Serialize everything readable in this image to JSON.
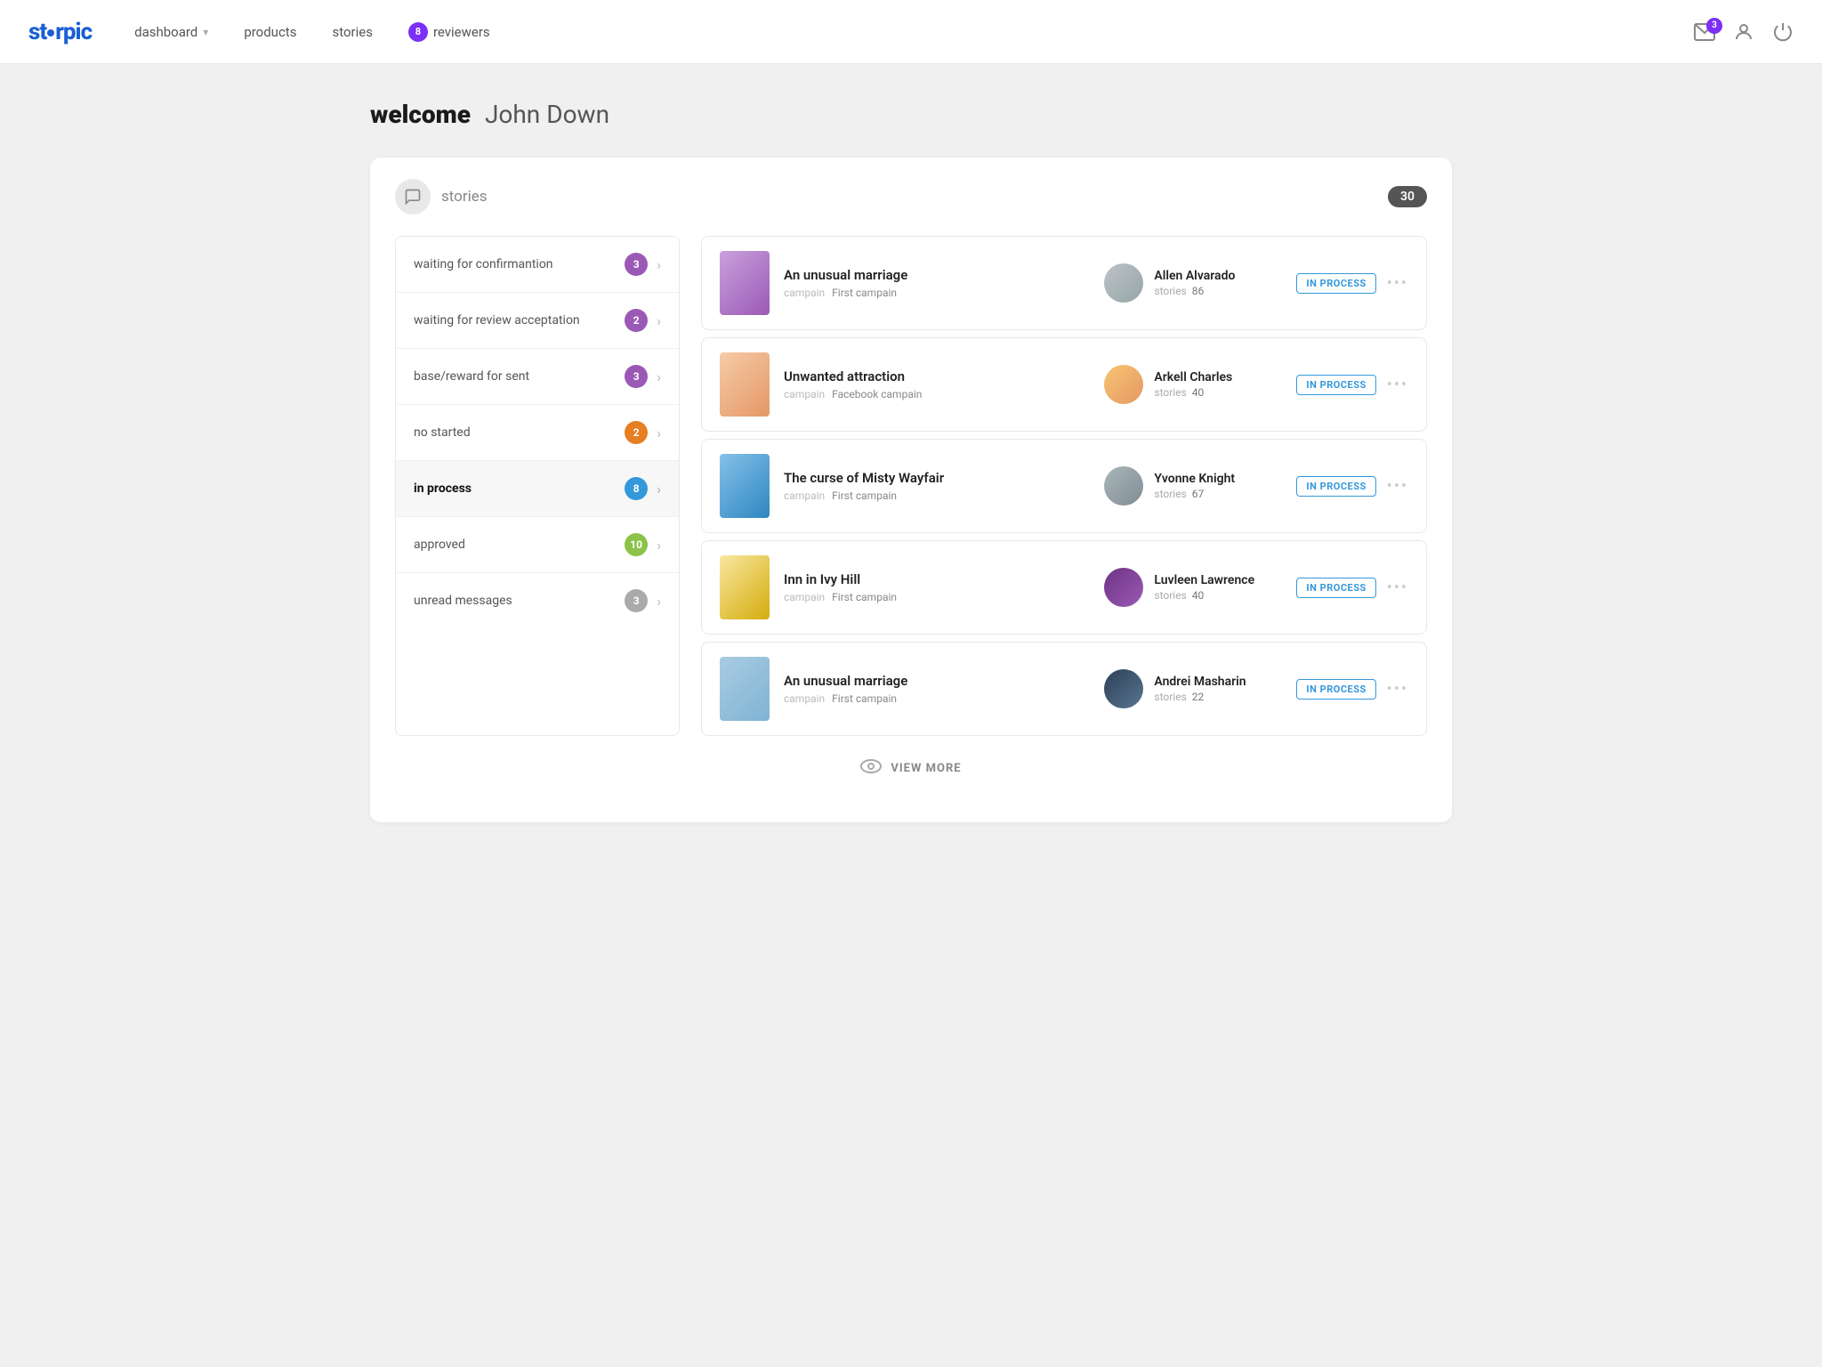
{
  "logo": {
    "text": "storpic"
  },
  "nav": {
    "dashboard_label": "dashboard",
    "products_label": "products",
    "stories_label": "stories",
    "reviewers_label": "reviewers",
    "reviewers_badge": "8",
    "mail_badge": "3"
  },
  "welcome": {
    "label": "welcome",
    "name": "John Down"
  },
  "stories_section": {
    "title": "stories",
    "count": "30"
  },
  "sidebar": {
    "items": [
      {
        "label": "waiting for confirmantion",
        "count": "3",
        "badge_class": "badge-purple"
      },
      {
        "label": "waiting for review acceptation",
        "count": "2",
        "badge_class": "badge-purple"
      },
      {
        "label": "base/reward for sent",
        "count": "3",
        "badge_class": "badge-purple"
      },
      {
        "label": "no started",
        "count": "2",
        "badge_class": "badge-orange"
      },
      {
        "label": "in process",
        "count": "8",
        "badge_class": "badge-blue",
        "active": true
      },
      {
        "label": "approved",
        "count": "10",
        "badge_class": "badge-green"
      },
      {
        "label": "unread messages",
        "count": "3",
        "badge_class": "badge-gray"
      }
    ]
  },
  "stories": [
    {
      "title": "An unusual marriage",
      "campaign_label": "campain",
      "campaign_value": "First campain",
      "cover_class": "cover-1",
      "reviewer_name": "Allen Alvarado",
      "reviewer_stories_label": "stories",
      "reviewer_stories_count": "86",
      "avatar_class": "avatar-1",
      "status": "IN PROCESS"
    },
    {
      "title": "Unwanted attraction",
      "campaign_label": "campain",
      "campaign_value": "Facebook campain",
      "cover_class": "cover-2",
      "reviewer_name": "Arkell Charles",
      "reviewer_stories_label": "stories",
      "reviewer_stories_count": "40",
      "avatar_class": "avatar-2",
      "status": "IN PROCESS"
    },
    {
      "title": "The curse of Misty Wayfair",
      "campaign_label": "campain",
      "campaign_value": "First campain",
      "cover_class": "cover-3",
      "reviewer_name": "Yvonne Knight",
      "reviewer_stories_label": "stories",
      "reviewer_stories_count": "67",
      "avatar_class": "avatar-3",
      "status": "IN PROCESS"
    },
    {
      "title": "Inn in Ivy Hill",
      "campaign_label": "campain",
      "campaign_value": "First campain",
      "cover_class": "cover-4",
      "reviewer_name": "Luvleen Lawrence",
      "reviewer_stories_label": "stories",
      "reviewer_stories_count": "40",
      "avatar_class": "avatar-4",
      "status": "IN PROCESS"
    },
    {
      "title": "An unusual marriage",
      "campaign_label": "campain",
      "campaign_value": "First campain",
      "cover_class": "cover-5",
      "reviewer_name": "Andrei Masharin",
      "reviewer_stories_label": "stories",
      "reviewer_stories_count": "22",
      "avatar_class": "avatar-5",
      "status": "IN PROCESS"
    }
  ],
  "view_more": {
    "label": "VIEW MORE"
  }
}
